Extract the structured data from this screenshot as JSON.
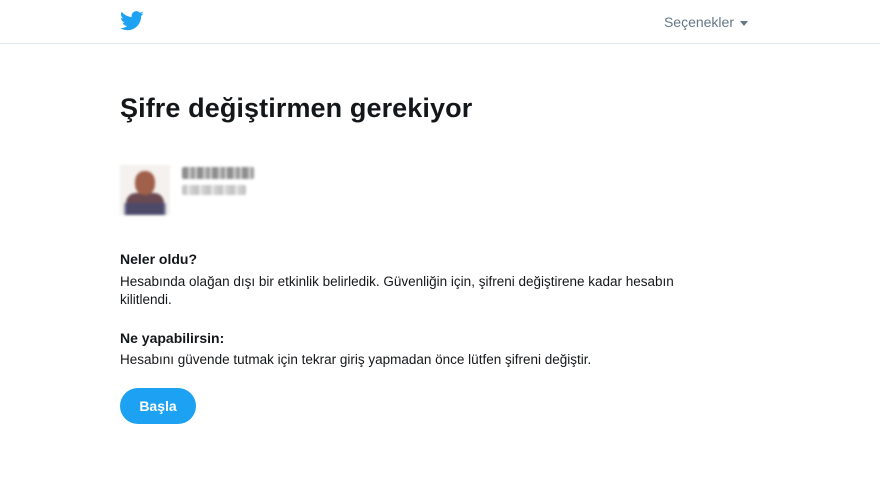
{
  "header": {
    "logo_icon": "twitter-bird-icon",
    "brand_color": "#1da1f2",
    "options_label": "Seçenekler"
  },
  "main": {
    "title": "Şifre değiştirmen gerekiyor",
    "account": {
      "avatar_icon": "avatar-image",
      "name_blurred": true,
      "handle_blurred": true
    },
    "what_happened": {
      "heading": "Neler oldu?",
      "text_line1": "Hesabında olağan dışı bir etkinlik belirledik. Güvenliğin için, şifreni değiştirene kadar hesabın",
      "text_line2": "kilitlendi."
    },
    "what_to_do": {
      "heading": "Ne yapabilirsin:",
      "text": "Hesabını güvende tutmak için tekrar giriş yapmadan önce lütfen şifreni değiştir."
    },
    "start_button_label": "Başla"
  }
}
